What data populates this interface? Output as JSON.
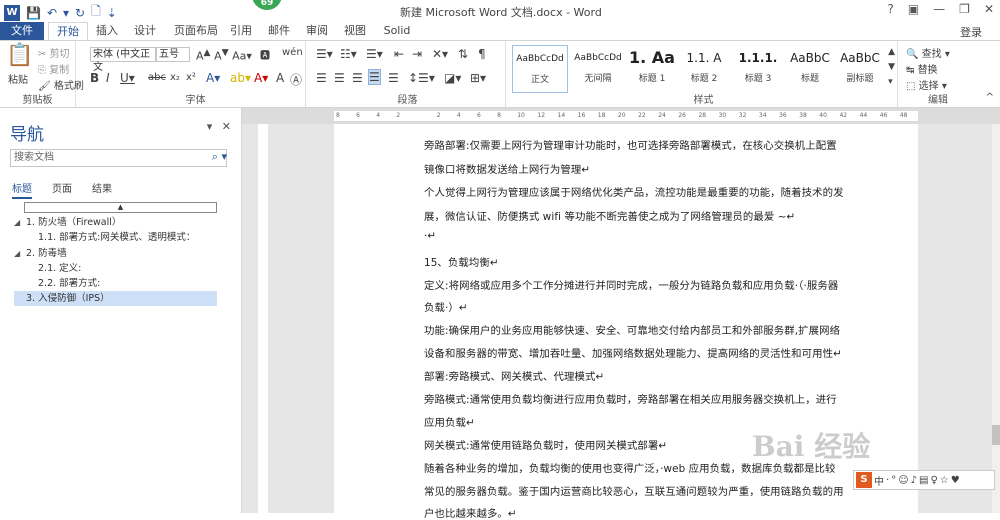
{
  "window": {
    "title": "新建 Microsoft Word 文档.docx - Word",
    "badge": "69",
    "help": "?",
    "login": "登录"
  },
  "tabs": [
    "文件",
    "开始",
    "插入",
    "设计",
    "页面布局",
    "引用",
    "邮件",
    "审阅",
    "视图",
    "Solid"
  ],
  "ribbon": {
    "clipboard": {
      "label": "剪贴板",
      "paste": "粘贴",
      "cut": "剪切",
      "copy": "复制",
      "format_painter": "格式刷"
    },
    "font": {
      "label": "字体",
      "font_name": "宋体 (中文正文",
      "font_size": "五号"
    },
    "paragraph": {
      "label": "段落"
    },
    "styles": {
      "label": "样式",
      "items": [
        {
          "sample": "AaBbCcDd",
          "name": "正文"
        },
        {
          "sample": "AaBbCcDd",
          "name": "无间隔"
        },
        {
          "sample": "1. Aa",
          "name": "标题 1"
        },
        {
          "sample": "1.1. A",
          "name": "标题 2"
        },
        {
          "sample": "1.1.1.",
          "name": "标题 3"
        },
        {
          "sample": "AaBbC",
          "name": "标题"
        },
        {
          "sample": "AaBbC",
          "name": "副标题"
        }
      ]
    },
    "editing": {
      "label": "编辑",
      "find": "查找",
      "replace": "替换",
      "select": "选择"
    }
  },
  "ruler": {
    "ticks": [
      "8",
      "6",
      "4",
      "2",
      "",
      "2",
      "4",
      "6",
      "8",
      "10",
      "12",
      "14",
      "16",
      "18",
      "20",
      "22",
      "24",
      "26",
      "28",
      "30",
      "32",
      "34",
      "36",
      "38",
      "40",
      "42",
      "44",
      "46",
      "48"
    ]
  },
  "nav": {
    "title": "导航",
    "search_placeholder": "搜索文档",
    "tabs": [
      "标题",
      "页面",
      "结果"
    ],
    "tree": [
      {
        "text": "1. 防火墙（Firewall）",
        "level": 1,
        "caret": "◢"
      },
      {
        "text": "1.1. 部署方式:网关模式、透明模式：",
        "level": 2,
        "caret": ""
      },
      {
        "text": "2. 防毒墙",
        "level": 1,
        "caret": "◢"
      },
      {
        "text": "2.1. 定义:",
        "level": 2,
        "caret": ""
      },
      {
        "text": "2.2. 部署方式:",
        "level": 2,
        "caret": ""
      },
      {
        "text": "3. 入侵防御（IPS）",
        "level": 1,
        "caret": "",
        "selected": true
      }
    ]
  },
  "document": {
    "lines": [
      "旁路部署:仅需要上网行为管理审计功能时，也可选择旁路部署模式，在核心交换机上配置",
      "镜像口将数据发送给上网行为管理↵",
      "个人觉得上网行为管理应该属于网络优化类产品，流控功能是最重要的功能，随着技术的发",
      "展，微信认证、防便携式 wifi 等功能不断完善使之成为了网络管理员的最爱 ~↵",
      "·↵",
      "15、负载均衡↵",
      "定义:将网络或应用多个工作分摊进行并同时完成，一般分为链路负载和应用负载·（·服务器",
      "负载·）↵",
      "功能:确保用户的业务应用能够快速、安全、可靠地交付给内部员工和外部服务群,扩展网络",
      "设备和服务器的带宽、增加吞吐量、加强网络数据处理能力、提高网络的灵活性和可用性↵",
      "部署:旁路模式、网关模式、代理模式↵",
      "旁路模式:通常使用负载均衡进行应用负载时，旁路部署在相关应用服务器交换机上，进行",
      "应用负载↵",
      "网关模式:通常使用链路负载时，使用网关模式部署↵",
      "随着各种业务的增加，负载均衡的使用也变得广泛，·web 应用负载，数据库负载都是比较",
      "常见的服务器负载。鉴于国内运营商比较恶心，互联互通问题较为严重，使用链路负载的用",
      "户也比越来越多。↵"
    ]
  },
  "watermark": "Bai 经验",
  "ime": {
    "logo": "S",
    "items": [
      "中",
      "·",
      "°",
      "☺",
      "♪",
      "▤",
      "♀",
      "☆",
      "♥"
    ]
  }
}
